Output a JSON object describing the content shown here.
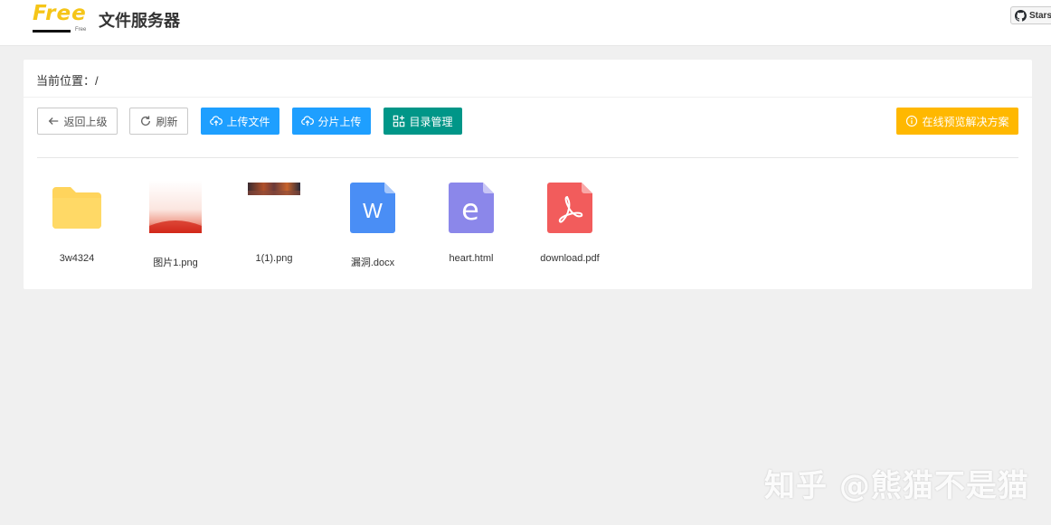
{
  "header": {
    "logo_text": "Free",
    "logo_sub": "Free",
    "app_title": "文件服务器",
    "stars_label": "Stars"
  },
  "breadcrumb": {
    "label": "当前位置：",
    "path": "/"
  },
  "toolbar": {
    "back_label": "返回上级",
    "refresh_label": "刷新",
    "upload_label": "上传文件",
    "chunk_upload_label": "分片上传",
    "dir_manage_label": "目录管理",
    "preview_solution_label": "在线预览解决方案"
  },
  "files": [
    {
      "name": "3w4324",
      "icon": "folder-icon"
    },
    {
      "name": "图片1.png",
      "icon": "image-thumbnail"
    },
    {
      "name": "1(1).png",
      "icon": "image-thumbnail"
    },
    {
      "name": "漏洞.docx",
      "icon": "word-doc-icon"
    },
    {
      "name": "heart.html",
      "icon": "html-file-icon"
    },
    {
      "name": "download.pdf",
      "icon": "pdf-file-icon"
    }
  ],
  "colors": {
    "blue": "#1e9fff",
    "green": "#009688",
    "orange": "#ffb800",
    "folder": "#ffd45c",
    "word": "#4a8ef5",
    "html": "#8b87ea",
    "pdf": "#f25c5c"
  },
  "watermark": "知乎 @熊猫不是猫"
}
